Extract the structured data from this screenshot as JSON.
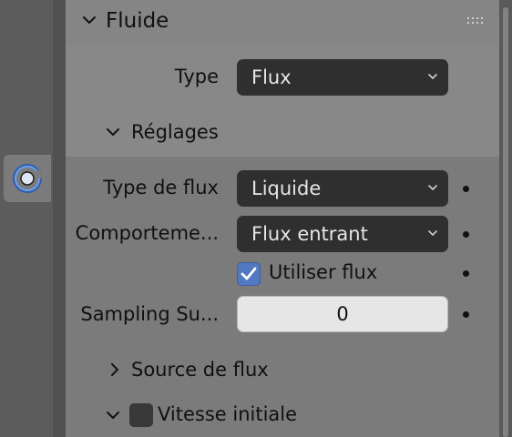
{
  "panel": {
    "title": "Fluide",
    "grip_icon": "drag-grip-icon",
    "type_label": "Type",
    "type_value": "Flux"
  },
  "reglages": {
    "title": "Réglages",
    "flow_type_label": "Type de flux",
    "flow_type_value": "Liquide",
    "behavior_label": "Comporteme...",
    "behavior_value": "Flux entrant",
    "use_flow_label": "Utiliser flux",
    "use_flow_checked": true,
    "sampling_label": "Sampling Su...",
    "sampling_value": "0"
  },
  "subpanels": {
    "source_title": "Source de flux",
    "initial_velocity_title": "Vitesse initiale",
    "initial_velocity_checked": false
  },
  "tabs": {
    "active_icon": "physics-icon"
  },
  "colors": {
    "accent_blue": "#5278c2",
    "dropdown_bg": "#2f2f2f",
    "panel_bg": "#7b7b7b"
  }
}
